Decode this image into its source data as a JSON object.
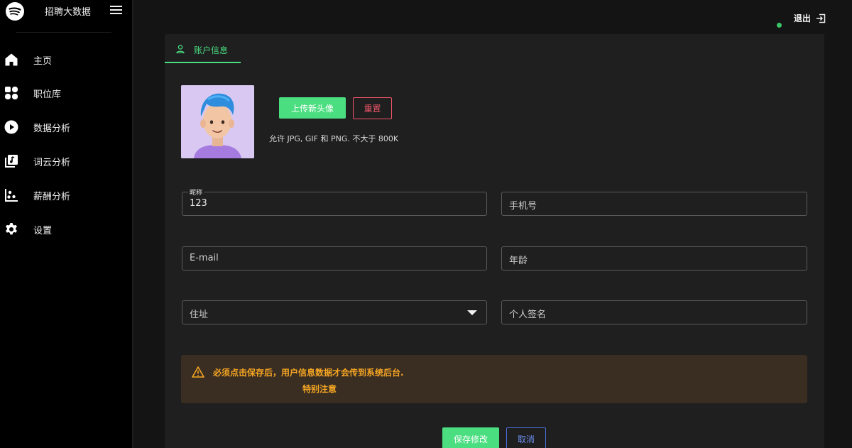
{
  "app": {
    "title": "招聘大数据"
  },
  "sidebar": {
    "items": [
      {
        "label": "主页",
        "icon": "home-icon"
      },
      {
        "label": "职位库",
        "icon": "grid-icon"
      },
      {
        "label": "数据分析",
        "icon": "play-circle-icon"
      },
      {
        "label": "词云分析",
        "icon": "library-icon"
      },
      {
        "label": "薪酬分析",
        "icon": "scatter-icon"
      },
      {
        "label": "设置",
        "icon": "gear-icon"
      }
    ]
  },
  "header": {
    "logout_label": "退出",
    "status_color": "#3ac569"
  },
  "card": {
    "tab_label": "账户信息",
    "upload_label": "上传新头像",
    "reset_label": "重置",
    "hint": "允许 JPG, GIF 和 PNG. 不大于 800K"
  },
  "form": {
    "nickname": {
      "legend": "昵称",
      "value": "123"
    },
    "phone": {
      "placeholder": "手机号"
    },
    "email": {
      "placeholder": "E-mail"
    },
    "age": {
      "placeholder": "年龄"
    },
    "address": {
      "placeholder": "住址"
    },
    "signature": {
      "placeholder": "个人签名"
    }
  },
  "alert": {
    "text": "必须点击保存后，用户信息数据才会传到系统后台.",
    "sub": "特别注意"
  },
  "actions": {
    "save_label": "保存修改",
    "cancel_label": "取消"
  },
  "colors": {
    "accent": "#4ade80",
    "danger": "#f0556b",
    "warning": "#f5a623",
    "link": "#6d8ff0"
  }
}
